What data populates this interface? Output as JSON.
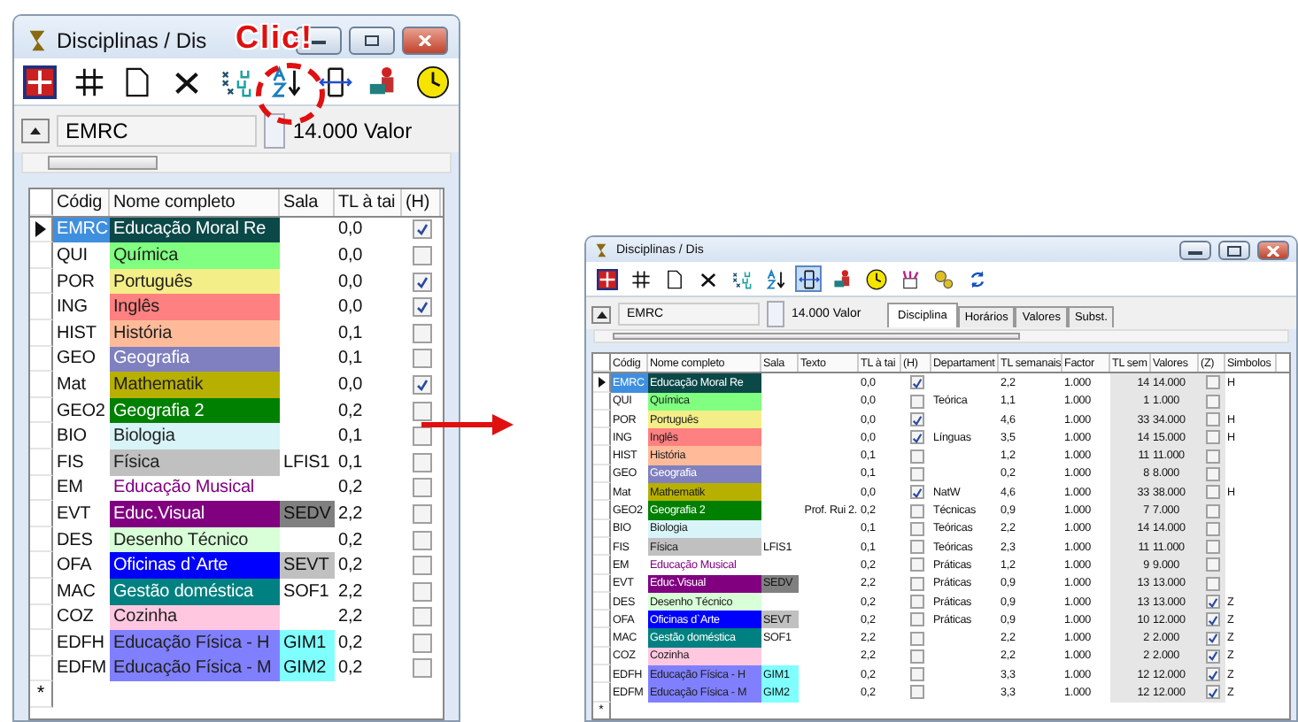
{
  "annotation": {
    "text": "Clic!"
  },
  "windows": [
    {
      "kind": "large",
      "title": "Disciplinas / Dis",
      "field": "EMRC",
      "value": "14.000 Valor",
      "new_row_marker": "*",
      "columns": [
        {
          "label": "Códig",
          "kind": "code"
        },
        {
          "label": "Nome completo",
          "kind": "name"
        },
        {
          "label": "Sala",
          "kind": "room"
        },
        {
          "label": "TL à tai",
          "kind": "tl"
        },
        {
          "label": "(H)",
          "kind": "h"
        }
      ],
      "rows": [
        {
          "selected": true,
          "code": "EMRC",
          "name": "Educação Moral Re",
          "color": "#0b4848",
          "tl": "0,0",
          "h": true
        },
        {
          "selected": false,
          "code": "QUI",
          "name": "Química",
          "color": "#80ff80",
          "tl": "0,0",
          "h": false
        },
        {
          "selected": false,
          "code": "POR",
          "name": "Português",
          "color": "#f4ee88",
          "tl": "0,0",
          "h": true
        },
        {
          "selected": false,
          "code": "ING",
          "name": "Inglês",
          "color": "#ff8080",
          "tl": "0,0",
          "h": true
        },
        {
          "selected": false,
          "code": "HIST",
          "name": "História",
          "color": "#ffbb99",
          "tl": "0,1",
          "h": false
        },
        {
          "selected": false,
          "code": "GEO",
          "name": "Geografia",
          "color": "#8080c0",
          "tl": "0,1",
          "h": false
        },
        {
          "selected": false,
          "code": "Mat",
          "name": "Mathematik",
          "color": "#b8b000",
          "tl": "0,0",
          "h": true
        },
        {
          "selected": false,
          "code": "GEO2",
          "name": "Geografia 2",
          "color": "#008000",
          "tl": "0,2",
          "h": false
        },
        {
          "selected": false,
          "code": "BIO",
          "name": "Biologia",
          "color": "#d8f4f8",
          "tl": "0,1",
          "h": false
        },
        {
          "selected": false,
          "code": "FIS",
          "name": "Física",
          "color": "#c0c0c0",
          "room": {
            "label": "LFIS1"
          },
          "tl": "0,1",
          "h": false
        },
        {
          "selected": false,
          "code": "EM",
          "name": "Educação Musical",
          "color": "#ffffff",
          "tl": "0,2",
          "h": false
        },
        {
          "selected": false,
          "code": "EVT",
          "name": "Educ.Visual",
          "color": "#800080",
          "room": {
            "label": "SEDV",
            "color": "#808080"
          },
          "tl": "2,2",
          "h": false
        },
        {
          "selected": false,
          "code": "DES",
          "name": "Desenho Técnico",
          "color": "#d8ffd8",
          "tl": "0,2",
          "h": false
        },
        {
          "selected": false,
          "code": "OFA",
          "name": "Oficinas d`Arte",
          "color": "#0000ff",
          "room": {
            "label": "SEVT",
            "color": "#c0c0c0"
          },
          "tl": "0,2",
          "h": false
        },
        {
          "selected": false,
          "code": "MAC",
          "name": "Gestão doméstica",
          "color": "#008080",
          "room": {
            "label": "SOF1"
          },
          "tl": "2,2",
          "h": false
        },
        {
          "selected": false,
          "code": "COZ",
          "name": "Cozinha",
          "color": "#ffc8e0",
          "tl": "2,2",
          "h": false
        },
        {
          "selected": false,
          "code": "EDFH",
          "name": "Educação Física - H",
          "color": "#8080ff",
          "room": {
            "label": "GIM1",
            "color": "#80ffff"
          },
          "tl": "0,2",
          "h": false
        },
        {
          "selected": false,
          "code": "EDFM",
          "name": "Educação Física - M",
          "color": "#8080ff",
          "room": {
            "label": "GIM2",
            "color": "#80ffff"
          },
          "tl": "0,2",
          "h": false
        }
      ]
    },
    {
      "kind": "small",
      "title": "Disciplinas / Dis",
      "field": "EMRC",
      "value": "14.000 Valor",
      "new_row_marker": "*",
      "tabs": [
        {
          "label": "Disciplina",
          "selected": true
        },
        {
          "label": "Horários",
          "selected": false
        },
        {
          "label": "Valores",
          "selected": false
        },
        {
          "label": "Subst.",
          "selected": false
        }
      ],
      "columns": [
        {
          "label": "Códig",
          "kind": "code"
        },
        {
          "label": "Nome completo",
          "kind": "name"
        },
        {
          "label": "Sala",
          "kind": "room"
        },
        {
          "label": "Texto",
          "kind": "text"
        },
        {
          "label": "TL à tai",
          "kind": "tl"
        },
        {
          "label": "(H)",
          "kind": "h"
        },
        {
          "label": "Departament",
          "kind": "dept"
        },
        {
          "label": "TL semanais",
          "kind": "weekly"
        },
        {
          "label": "Factor",
          "kind": "factor"
        },
        {
          "label": "TL sem",
          "kind": "weekly2"
        },
        {
          "label": "Valores",
          "kind": "value"
        },
        {
          "label": "(Z)",
          "kind": "z"
        },
        {
          "label": "Simbolos",
          "kind": "symbol"
        }
      ],
      "rows": [
        {
          "selected": true,
          "code": "EMRC",
          "name": "Educação Moral Re",
          "color": "#0b4848",
          "tl": "0,0",
          "h": true,
          "weekly": "2,2",
          "factor": "1.000",
          "weekly2": "14",
          "value": "14.000",
          "z": false,
          "symbol": "H"
        },
        {
          "selected": false,
          "code": "QUI",
          "name": "Química",
          "color": "#80ff80",
          "tl": "0,0",
          "h": false,
          "dept": "Teórica",
          "weekly": "1,1",
          "factor": "1.000",
          "weekly2": "1",
          "value": "1.000",
          "z": false
        },
        {
          "selected": false,
          "code": "POR",
          "name": "Português",
          "color": "#f4ee88",
          "tl": "0,0",
          "h": true,
          "weekly": "4,6",
          "factor": "1.000",
          "weekly2": "33",
          "value": "34.000",
          "z": false,
          "symbol": "H"
        },
        {
          "selected": false,
          "code": "ING",
          "name": "Inglês",
          "color": "#ff8080",
          "tl": "0,0",
          "h": true,
          "dept": "Línguas",
          "weekly": "3,5",
          "factor": "1.000",
          "weekly2": "14",
          "value": "15.000",
          "z": false,
          "symbol": "H"
        },
        {
          "selected": false,
          "code": "HIST",
          "name": "História",
          "color": "#ffbb99",
          "tl": "0,1",
          "h": false,
          "weekly": "1,2",
          "factor": "1.000",
          "weekly2": "11",
          "value": "11.000",
          "z": false
        },
        {
          "selected": false,
          "code": "GEO",
          "name": "Geografia",
          "color": "#8080c0",
          "tl": "0,1",
          "h": false,
          "weekly": "0,2",
          "factor": "1.000",
          "weekly2": "8",
          "value": "8.000",
          "z": false
        },
        {
          "selected": false,
          "code": "Mat",
          "name": "Mathematik",
          "color": "#b8b000",
          "tl": "0,0",
          "h": true,
          "dept": "NatW",
          "weekly": "4,6",
          "factor": "1.000",
          "weekly2": "33",
          "value": "38.000",
          "z": false,
          "symbol": "H"
        },
        {
          "selected": false,
          "code": "GEO2",
          "name": "Geografia 2",
          "color": "#008000",
          "text": "Prof. Rui 2.",
          "tl": "0,2",
          "h": false,
          "dept": "Técnicas",
          "weekly": "0,9",
          "factor": "1.000",
          "weekly2": "7",
          "value": "7.000",
          "z": false
        },
        {
          "selected": false,
          "code": "BIO",
          "name": "Biologia",
          "color": "#d8f4f8",
          "tl": "0,1",
          "h": false,
          "dept": "Teóricas",
          "weekly": "2,2",
          "factor": "1.000",
          "weekly2": "14",
          "value": "14.000",
          "z": false
        },
        {
          "selected": false,
          "code": "FIS",
          "name": "Física",
          "color": "#c0c0c0",
          "room": {
            "label": "LFIS1"
          },
          "tl": "0,1",
          "h": false,
          "dept": "Teóricas",
          "weekly": "2,3",
          "factor": "1.000",
          "weekly2": "11",
          "value": "11.000",
          "z": false
        },
        {
          "selected": false,
          "code": "EM",
          "name": "Educação Musical",
          "color": "#ffffff",
          "tl": "0,2",
          "h": false,
          "dept": "Práticas",
          "weekly": "1,2",
          "factor": "1.000",
          "weekly2": "9",
          "value": "9.000",
          "z": false
        },
        {
          "selected": false,
          "code": "EVT",
          "name": "Educ.Visual",
          "color": "#800080",
          "room": {
            "label": "SEDV",
            "color": "#808080"
          },
          "tl": "2,2",
          "h": false,
          "dept": "Práticas",
          "weekly": "0,9",
          "factor": "1.000",
          "weekly2": "13",
          "value": "13.000",
          "z": false
        },
        {
          "selected": false,
          "code": "DES",
          "name": "Desenho Técnico",
          "color": "#d8ffd8",
          "tl": "0,2",
          "h": false,
          "dept": "Práticas",
          "weekly": "0,9",
          "factor": "1.000",
          "weekly2": "13",
          "value": "13.000",
          "z": true,
          "symbol": "Z"
        },
        {
          "selected": false,
          "code": "OFA",
          "name": "Oficinas d`Arte",
          "color": "#0000ff",
          "room": {
            "label": "SEVT",
            "color": "#c0c0c0"
          },
          "tl": "0,2",
          "h": false,
          "dept": "Práticas",
          "weekly": "0,9",
          "factor": "1.000",
          "weekly2": "10",
          "value": "12.000",
          "z": true,
          "symbol": "Z"
        },
        {
          "selected": false,
          "code": "MAC",
          "name": "Gestão doméstica",
          "color": "#008080",
          "room": {
            "label": "SOF1"
          },
          "tl": "2,2",
          "h": false,
          "weekly": "2,2",
          "factor": "1.000",
          "weekly2": "2",
          "value": "2.000",
          "z": true,
          "symbol": "Z"
        },
        {
          "selected": false,
          "code": "COZ",
          "name": "Cozinha",
          "color": "#ffc8e0",
          "tl": "2,2",
          "h": false,
          "weekly": "2,2",
          "factor": "1.000",
          "weekly2": "2",
          "value": "2.000",
          "z": true,
          "symbol": "Z"
        },
        {
          "selected": false,
          "code": "EDFH",
          "name": "Educação Física - H",
          "color": "#8080ff",
          "room": {
            "label": "GIM1",
            "color": "#80ffff"
          },
          "tl": "0,2",
          "h": false,
          "weekly": "3,3",
          "factor": "1.000",
          "weekly2": "12",
          "value": "12.000",
          "z": true,
          "symbol": "Z"
        },
        {
          "selected": false,
          "code": "EDFM",
          "name": "Educação Física - M",
          "color": "#8080ff",
          "room": {
            "label": "GIM2",
            "color": "#80ffff"
          },
          "tl": "0,2",
          "h": false,
          "weekly": "3,3",
          "factor": "1.000",
          "weekly2": "12",
          "value": "12.000",
          "z": true,
          "symbol": "Z"
        }
      ]
    }
  ]
}
